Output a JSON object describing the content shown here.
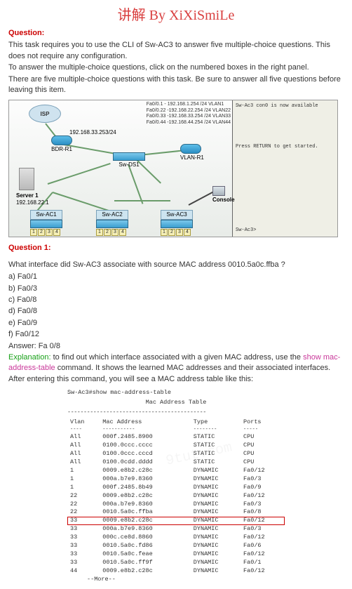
{
  "header_title": "讲解 By XiXiSmiLe",
  "question_label": "Question:",
  "intro": {
    "p1": "This task requires you to use the CLI of Sw-AC3 to answer five multiple-choice questions. This does not require any configuration.",
    "p2": "To answer the multiple-choice questions, click on the numbered boxes in the right panel.",
    "p3": "There are five multiple-choice questions with this task. Be sure to answer all five questions before leaving this item."
  },
  "diagram": {
    "fa_lines": {
      "l1": "Fa0/0.1  - 192.168.1.254 /24  VLAN1",
      "l2": "Fa0/0.22 -192.168.22.254 /24  VLAN22",
      "l3": "Fa0/0.33 -192.168.33.254 /24  VLAN33",
      "l4": "Fa0/0.44 -192.168.44.254 /24  VLAN44"
    },
    "isp": "ISP",
    "bdr_r1": "BDR-R1",
    "bdr_ip": "192.168.33.253/24",
    "sw_ds1": "Sw-DS1",
    "vlan_r1": "VLAN-R1",
    "server_lbl": "Server 1",
    "server_ip": "192.168.22.1",
    "sw_ac1": "Sw-AC1",
    "sw_ac2": "Sw-AC2",
    "sw_ac3": "Sw-AC3",
    "console_lbl": "Console",
    "console": {
      "l1": "Sw-Ac3 con0 is now available",
      "l2": "Press RETURN to get started.",
      "l3": "Sw-Ac3>"
    }
  },
  "q1": {
    "label": "Question 1:",
    "stem": "What interface did Sw-AC3 associate with source MAC address 0010.5a0c.ffba ?",
    "opts": {
      "a": "a) Fa0/1",
      "b": "b) Fa0/3",
      "c": "c) Fa0/8",
      "d": "d) Fa0/8",
      "e": "e) Fa0/9",
      "f": "f) Fa0/12"
    },
    "answer_line": "Answer: Fa 0/8",
    "expl_label": "Explanation:",
    "expl_text_1": " to find out which interface associated with a given MAC address, use the ",
    "expl_cmd": "show mac-address-table",
    "expl_text_2": " command. It shows the learned MAC addresses and their associated interfaces. After entering this command, you will see a MAC address table like this:"
  },
  "mac_table": {
    "prompt": "Sw-Ac3#show mac-address-table",
    "banner": "Mac Address Table",
    "dashes": "-------------------------------------------",
    "headers": {
      "vlan": "Vlan",
      "mac": "Mac Address",
      "type": "Type",
      "ports": "Ports"
    },
    "col_dashes": {
      "vlan": "----",
      "mac": "-----------",
      "type": "--------",
      "ports": "-----"
    },
    "chart_data": {
      "type": "table",
      "columns": [
        "Vlan",
        "Mac Address",
        "Type",
        "Ports"
      ],
      "highlight_row_index": 10,
      "rows": [
        [
          "All",
          "000f.2485.8900",
          "STATIC",
          "CPU"
        ],
        [
          "All",
          "0100.0ccc.cccc",
          "STATIC",
          "CPU"
        ],
        [
          "All",
          "0100.0ccc.cccd",
          "STATIC",
          "CPU"
        ],
        [
          "All",
          "0100.0cdd.dddd",
          "STATIC",
          "CPU"
        ],
        [
          "1",
          "0009.e8b2.c28c",
          "DYNAMIC",
          "Fa0/12"
        ],
        [
          "1",
          "000a.b7e9.8360",
          "DYNAMIC",
          "Fa0/3"
        ],
        [
          "1",
          "000f.2485.8b49",
          "DYNAMIC",
          "Fa0/9"
        ],
        [
          "22",
          "0009.e8b2.c28c",
          "DYNAMIC",
          "Fa0/12"
        ],
        [
          "22",
          "000a.b7e9.8360",
          "DYNAMIC",
          "Fa0/3"
        ],
        [
          "22",
          "0010.5a0c.ffba",
          "DYNAMIC",
          "Fa0/8"
        ],
        [
          "33",
          "0009.e8b2.c28c",
          "DYNAMIC",
          "Fa0/12"
        ],
        [
          "33",
          "000a.b7e9.8360",
          "DYNAMIC",
          "Fa0/3"
        ],
        [
          "33",
          "000c.ce8d.8860",
          "DYNAMIC",
          "Fa0/12"
        ],
        [
          "33",
          "0010.5a0c.fd86",
          "DYNAMIC",
          "Fa0/6"
        ],
        [
          "33",
          "0010.5a0c.feae",
          "DYNAMIC",
          "Fa0/12"
        ],
        [
          "33",
          "0010.5a0c.ff9f",
          "DYNAMIC",
          "Fa0/1"
        ],
        [
          "44",
          "0009.e8b2.c28c",
          "DYNAMIC",
          "Fa0/12"
        ]
      ]
    },
    "more": "--More--"
  }
}
